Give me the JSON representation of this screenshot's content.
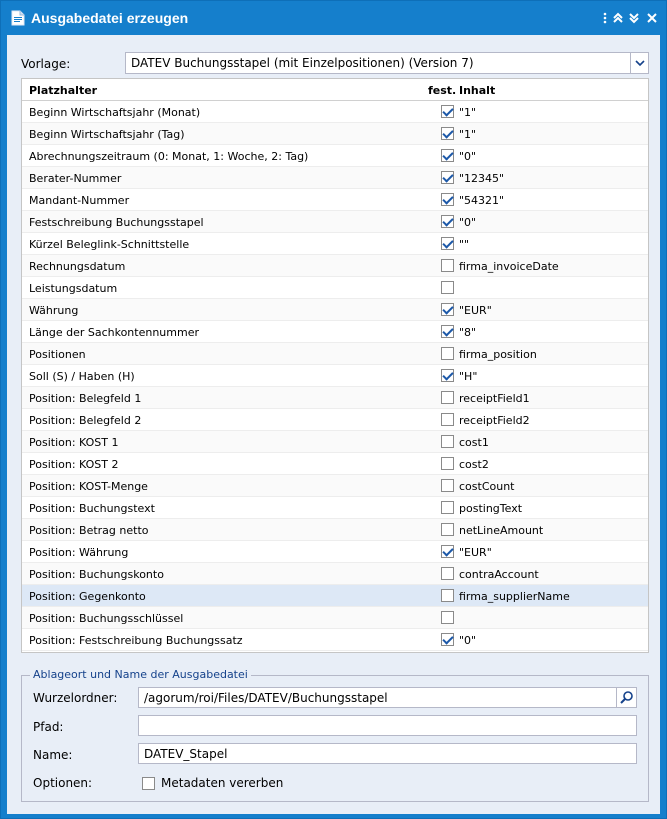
{
  "window": {
    "title": "Ausgabedatei erzeugen"
  },
  "template": {
    "label": "Vorlage:",
    "value": "DATEV Buchungsstapel (mit Einzelpositionen) (Version 7)"
  },
  "grid": {
    "columns": [
      "Platzhalter",
      "fest.",
      "Inhalt"
    ],
    "rows": [
      {
        "name": "Beginn Wirtschaftsjahr (Monat)",
        "fixed": true,
        "content": "\"1\""
      },
      {
        "name": "Beginn Wirtschaftsjahr (Tag)",
        "fixed": true,
        "content": "\"1\""
      },
      {
        "name": "Abrechnungszeitraum (0: Monat, 1: Woche, 2: Tag)",
        "fixed": true,
        "content": "\"0\""
      },
      {
        "name": "Berater-Nummer",
        "fixed": true,
        "content": "\"12345\""
      },
      {
        "name": "Mandant-Nummer",
        "fixed": true,
        "content": "\"54321\""
      },
      {
        "name": "Festschreibung Buchungsstapel",
        "fixed": true,
        "content": "\"0\""
      },
      {
        "name": "Kürzel Beleglink-Schnittstelle",
        "fixed": true,
        "content": "\"\""
      },
      {
        "name": "Rechnungsdatum",
        "fixed": false,
        "content": "firma_invoiceDate"
      },
      {
        "name": "Leistungsdatum",
        "fixed": false,
        "content": ""
      },
      {
        "name": "Währung",
        "fixed": true,
        "content": "\"EUR\""
      },
      {
        "name": "Länge der Sachkontennummer",
        "fixed": true,
        "content": "\"8\""
      },
      {
        "name": "Positionen",
        "fixed": false,
        "content": "firma_position"
      },
      {
        "name": "Soll (S) / Haben (H)",
        "fixed": true,
        "content": "\"H\""
      },
      {
        "name": "Position: Belegfeld 1",
        "fixed": false,
        "content": "receiptField1"
      },
      {
        "name": "Position: Belegfeld 2",
        "fixed": false,
        "content": "receiptField2"
      },
      {
        "name": "Position: KOST 1",
        "fixed": false,
        "content": "cost1"
      },
      {
        "name": "Position: KOST 2",
        "fixed": false,
        "content": "cost2"
      },
      {
        "name": "Position: KOST-Menge",
        "fixed": false,
        "content": "costCount"
      },
      {
        "name": "Position: Buchungstext",
        "fixed": false,
        "content": "postingText"
      },
      {
        "name": "Position: Betrag netto",
        "fixed": false,
        "content": "netLineAmount"
      },
      {
        "name": "Position: Währung",
        "fixed": true,
        "content": "\"EUR\""
      },
      {
        "name": "Position: Buchungskonto",
        "fixed": false,
        "content": "contraAccount"
      },
      {
        "name": "Position: Gegenkonto",
        "fixed": false,
        "content": "firma_supplierName",
        "selected": true
      },
      {
        "name": "Position: Buchungsschlüssel",
        "fixed": false,
        "content": ""
      },
      {
        "name": "Position: Festschreibung Buchungssatz",
        "fixed": true,
        "content": "\"0\""
      }
    ]
  },
  "output": {
    "legend": "Ablageort und Name der Ausgabedatei",
    "root_label": "Wurzelordner:",
    "root_value": "/agorum/roi/Files/DATEV/Buchungsstapel",
    "path_label": "Pfad:",
    "path_value": "",
    "name_label": "Name:",
    "name_value": "DATEV_Stapel",
    "options_label": "Optionen:",
    "inherit_metadata_label": "Metadaten vererben",
    "inherit_metadata_checked": false
  },
  "colors": {
    "titlebar": "#157fcc",
    "checkmark": "#1c58a8",
    "selected_row": "#dde8f6"
  }
}
